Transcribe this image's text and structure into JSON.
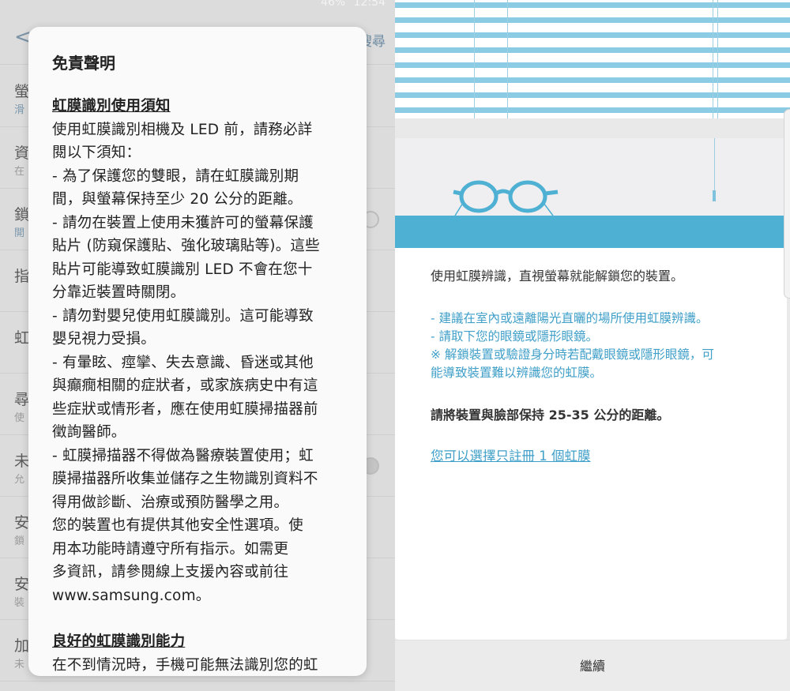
{
  "left": {
    "status_bar": {
      "battery": "46%",
      "time": "12:54"
    },
    "app_bar": {
      "back_glyph": "<",
      "action_label": "搜尋"
    },
    "background_rows": [
      {
        "title": "螢",
        "subtitle": "滑",
        "subtitle_blue": true
      },
      {
        "title": "資",
        "subtitle": "在"
      },
      {
        "title": "鎖",
        "subtitle": "開",
        "subtitle_blue": true,
        "toggle": "empty"
      },
      {
        "title": "指",
        "subtitle": ""
      },
      {
        "title": "虹",
        "subtitle": ""
      },
      {
        "title": "尋",
        "subtitle": "使"
      },
      {
        "title": "未",
        "subtitle": "允",
        "toggle": "filled"
      },
      {
        "title": "安",
        "subtitle": "鎖"
      },
      {
        "title": "安",
        "subtitle": "裝"
      },
      {
        "title": "加",
        "subtitle": "未"
      }
    ],
    "dialog": {
      "title": "免責聲明",
      "section1_heading": "虹膜識別使用須知",
      "lines": [
        "使用虹膜識別相機及 LED 前，請務必詳",
        "閱以下須知：",
        "- 為了保護您的雙眼，請在虹膜識別期",
        "間，與螢幕保持至少 20 公分的距離。",
        "- 請勿在裝置上使用未獲許可的螢幕保護",
        "貼片 (防窺保護貼、強化玻璃貼等)。這些",
        "貼片可能導致虹膜識別 LED 不會在您十",
        "分靠近裝置時關閉。",
        "- 請勿對嬰兒使用虹膜識別。這可能導致",
        "嬰兒視力受損。",
        "- 有暈眩、痙攣、失去意識、昏迷或其他",
        "與癲癇相關的症狀者，或家族病史中有這",
        "些症狀或情形者，應在使用虹膜掃描器前",
        "徵詢醫師。",
        "- 虹膜掃描器不得做為醫療裝置使用；虹",
        "膜掃描器所收集並儲存之生物識別資料不",
        "得用做診斷、治療或預防醫學之用。",
        "您的裝置也有提供其他安全性選項。使",
        "用本功能時請遵守所有指示。如需更",
        "多資訊，請參閱線上支援內容或前往",
        "www.samsung.com。"
      ],
      "section2_heading": "良好的虹膜識別能力",
      "section2_cut_line": "在不到情況時，手機可能無法識別您的虹"
    }
  },
  "right": {
    "intro": "使用虹膜辨識，直視螢幕就能解鎖您的裝置。",
    "tips": [
      "- 建議在室內或遠離陽光直曬的場所使用虹膜辨識。",
      "- 請取下您的眼鏡或隱形眼鏡。",
      "※ 解鎖裝置或驗證身分時若配戴眼鏡或隱形眼鏡，可",
      "能導致裝置難以辨識您的虹膜。"
    ],
    "distance_note": "請將裝置與臉部保持 25-35 公分的距離。",
    "one_iris_link": "您可以選擇只註冊 1 個虹膜",
    "continue_label": "繼續"
  },
  "colors": {
    "accent_blue": "#3f9fc8",
    "blind_blue": "#8ccbe4",
    "sill_blue": "#4eb0d2"
  }
}
